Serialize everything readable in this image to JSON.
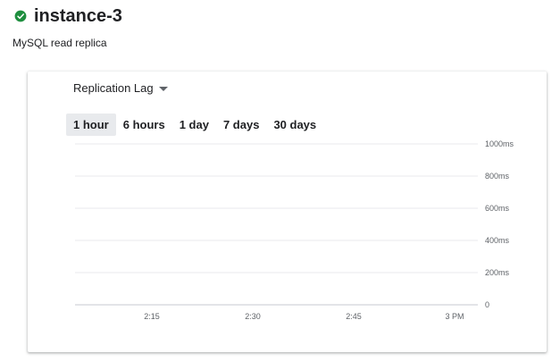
{
  "header": {
    "status_icon": "check-circle-icon",
    "status_color": "#1e8e3e",
    "instance_name": "instance-3",
    "description": "MySQL read replica"
  },
  "card": {
    "metric_selector": {
      "label": "Replication Lag",
      "icon": "caret-down-icon"
    },
    "time_ranges": [
      {
        "label": "1 hour",
        "active": true
      },
      {
        "label": "6 hours",
        "active": false
      },
      {
        "label": "1 day",
        "active": false
      },
      {
        "label": "7 days",
        "active": false
      },
      {
        "label": "30 days",
        "active": false
      }
    ]
  },
  "chart_data": {
    "type": "line",
    "title": "",
    "xlabel": "",
    "ylabel": "",
    "x_ticks": [
      "2:15",
      "2:30",
      "2:45",
      "3 PM"
    ],
    "y_ticks": [
      "0",
      "200ms",
      "400ms",
      "600ms",
      "800ms",
      "1000ms"
    ],
    "ylim": [
      0,
      1000
    ],
    "y_unit": "ms",
    "grid": true,
    "series": []
  }
}
